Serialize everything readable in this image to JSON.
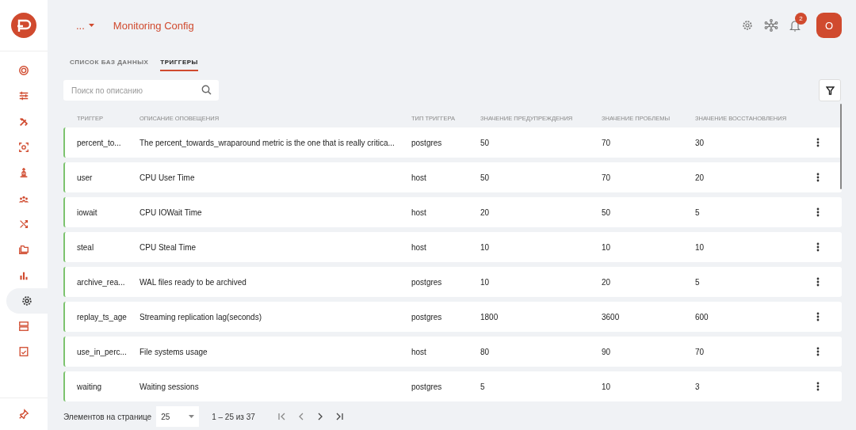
{
  "sidebar": {
    "items": [
      {
        "selected": false
      },
      {
        "selected": false
      },
      {
        "selected": false
      },
      {
        "selected": false
      },
      {
        "selected": false
      },
      {
        "selected": false
      },
      {
        "selected": false
      },
      {
        "selected": false
      },
      {
        "selected": false
      },
      {
        "selected": true
      },
      {
        "selected": false
      },
      {
        "selected": false
      }
    ]
  },
  "header": {
    "breadcrumb": "...",
    "title": "Monitoring Config",
    "notifications": "2",
    "avatar": "O"
  },
  "tabs": [
    {
      "label": "СПИСОК БАЗ ДАННЫХ",
      "selected": false
    },
    {
      "label": "ТРИГГЕРЫ",
      "selected": true
    }
  ],
  "search": {
    "placeholder": "Поиск по описанию"
  },
  "table": {
    "columns": [
      "ТРИГГЕР",
      "ОПИСАНИЕ ОПОВЕЩЕНИЯ",
      "ТИП ТРИГГЕРА",
      "ЗНАЧЕНИЕ ПРЕДУПРЕЖДЕНИЯ",
      "ЗНАЧЕНИЕ ПРОБЛЕМЫ",
      "ЗНАЧЕНИЕ ВОССТАНОВЛЕНИЯ"
    ],
    "rows": [
      [
        "percent_to...",
        "The percent_towards_wraparound metric is the one that is really critica...",
        "postgres",
        "50",
        "70",
        "30"
      ],
      [
        "user",
        "CPU User Time",
        "host",
        "50",
        "70",
        "20"
      ],
      [
        "iowait",
        "CPU IOWait Time",
        "host",
        "20",
        "50",
        "5"
      ],
      [
        "steal",
        "CPU Steal Time",
        "host",
        "10",
        "10",
        "10"
      ],
      [
        "archive_rea...",
        "WAL files ready to be archived",
        "postgres",
        "10",
        "20",
        "5"
      ],
      [
        "replay_ts_age",
        "Streaming replication lag(seconds)",
        "postgres",
        "1800",
        "3600",
        "600"
      ],
      [
        "use_in_perc...",
        "File systems usage",
        "host",
        "80",
        "90",
        "70"
      ],
      [
        "waiting",
        "Waiting sessions",
        "postgres",
        "5",
        "10",
        "3"
      ]
    ]
  },
  "pagination": {
    "page_size_label": "Элементов на странице",
    "page_size": "25",
    "range": "1 – 25 из 37"
  }
}
